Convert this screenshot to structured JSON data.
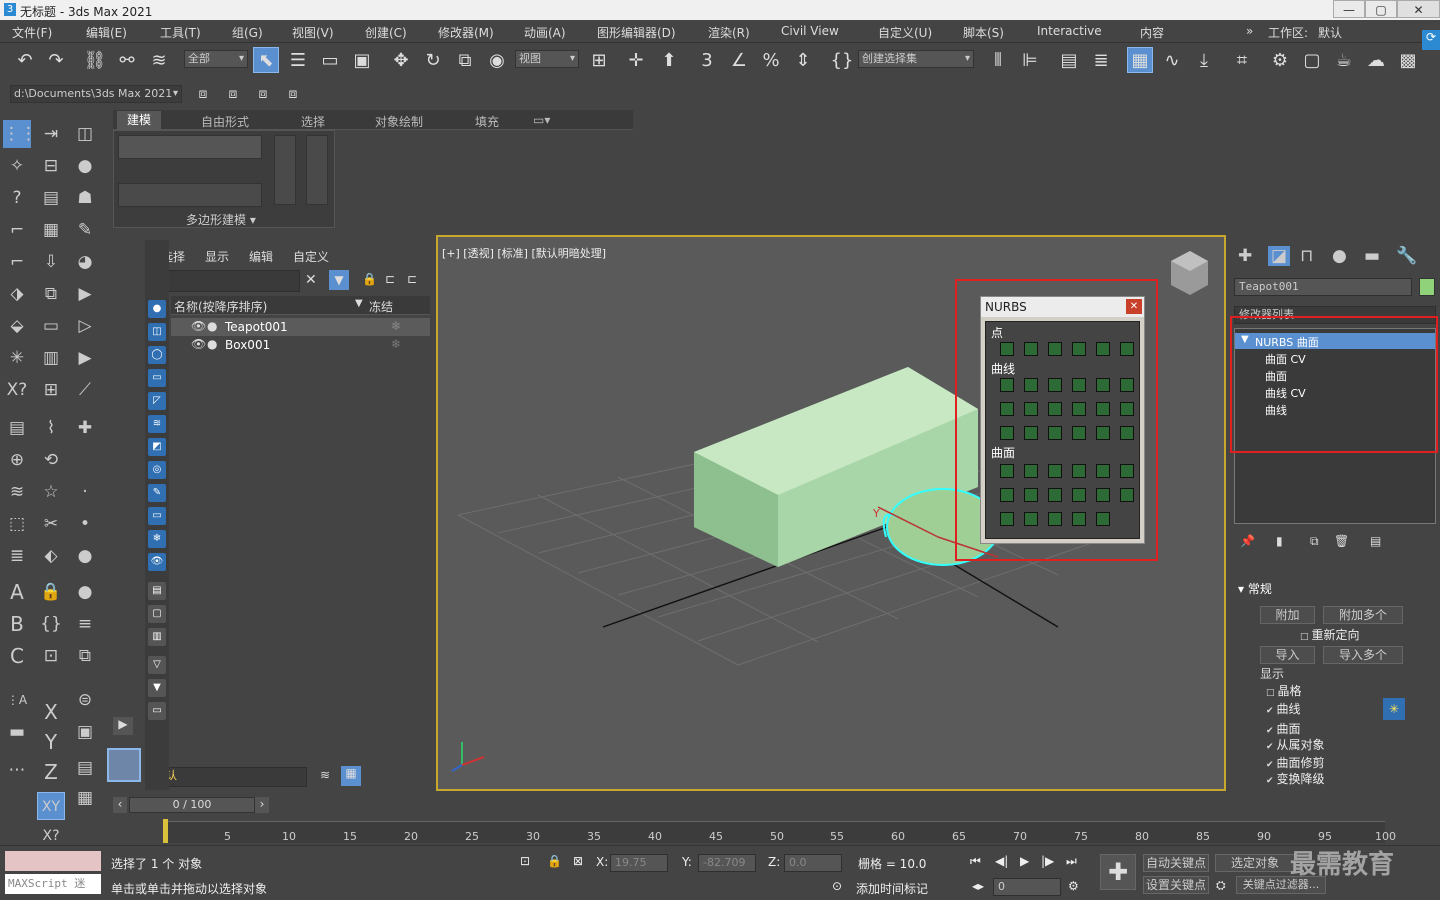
{
  "window": {
    "title": "无标题 - 3ds Max 2021",
    "min": "—",
    "max": "▢",
    "close": "✕"
  },
  "menu": [
    "文件(F)",
    "编辑(E)",
    "工具(T)",
    "组(G)",
    "视图(V)",
    "创建(C)",
    "修改器(M)",
    "动画(A)",
    "图形编辑器(D)",
    "渲染(R)",
    "Civil View",
    "自定义(U)",
    "脚本(S)",
    "Interactive",
    "内容"
  ],
  "workspace": {
    "label": "工作区:",
    "value": "默认"
  },
  "toolbar": {
    "filter_dropdown": "全部",
    "view_dropdown": "视图",
    "selection_set": "创建选择集"
  },
  "path": "d:\\Documents\\3ds Max 2021",
  "ribbon": {
    "tabs": [
      "建模",
      "自由形式",
      "选择",
      "对象绘制",
      "填充"
    ],
    "footer": "多边形建模 ▾"
  },
  "scene_explorer": {
    "menu": [
      "选择",
      "显示",
      "编辑",
      "自定义"
    ],
    "col_name": "名称(按降序排序)",
    "col_frozen": "冻结",
    "rows": [
      "Teapot001",
      "Box001"
    ],
    "layer": "默认"
  },
  "viewport": {
    "label": "[+] [透视] [标准] [默认明暗处理]"
  },
  "nurbs_panel": {
    "title": "NURBS",
    "sec_points": "点",
    "sec_curves": "曲线",
    "sec_surfaces": "曲面"
  },
  "command_panel": {
    "object_name": "Teapot001",
    "modifier_list": "修改器列表",
    "stack": [
      "NURBS 曲面",
      "曲面 CV",
      "曲面",
      "曲线 CV",
      "曲线"
    ],
    "rollout_title": "常规",
    "btn_attach": "附加",
    "btn_attach_multi": "附加多个",
    "reorient": "重新定向",
    "btn_import": "导入",
    "btn_import_multi": "导入多个",
    "display_label": "显示",
    "display_items": [
      "晶格",
      "曲线",
      "曲面",
      "从属对象",
      "曲面修剪",
      "变换降级"
    ]
  },
  "timeline": {
    "frame": "0 / 100",
    "ticks": [
      "5",
      "10",
      "15",
      "20",
      "25",
      "30",
      "35",
      "40",
      "45",
      "50",
      "55",
      "60",
      "65",
      "70",
      "75",
      "80",
      "85",
      "90",
      "95",
      "100"
    ]
  },
  "status": {
    "selected": "选择了 1 个 对象",
    "hint": "单击或单击并拖动以选择对象",
    "x_label": "X:",
    "x": "19.75",
    "y_label": "Y:",
    "y": "-82.709",
    "z_label": "Z:",
    "z": "0.0",
    "grid": "栅格 = 10.0",
    "add_time_tag": "添加时间标记",
    "auto_key": "自动关键点",
    "selected_obj": "选定对象",
    "set_key": "设置关键点",
    "key_filter": "关键点过滤器...",
    "frame_field": "0",
    "maxscript": "MAXScript 迷"
  },
  "watermark": "最需教育"
}
